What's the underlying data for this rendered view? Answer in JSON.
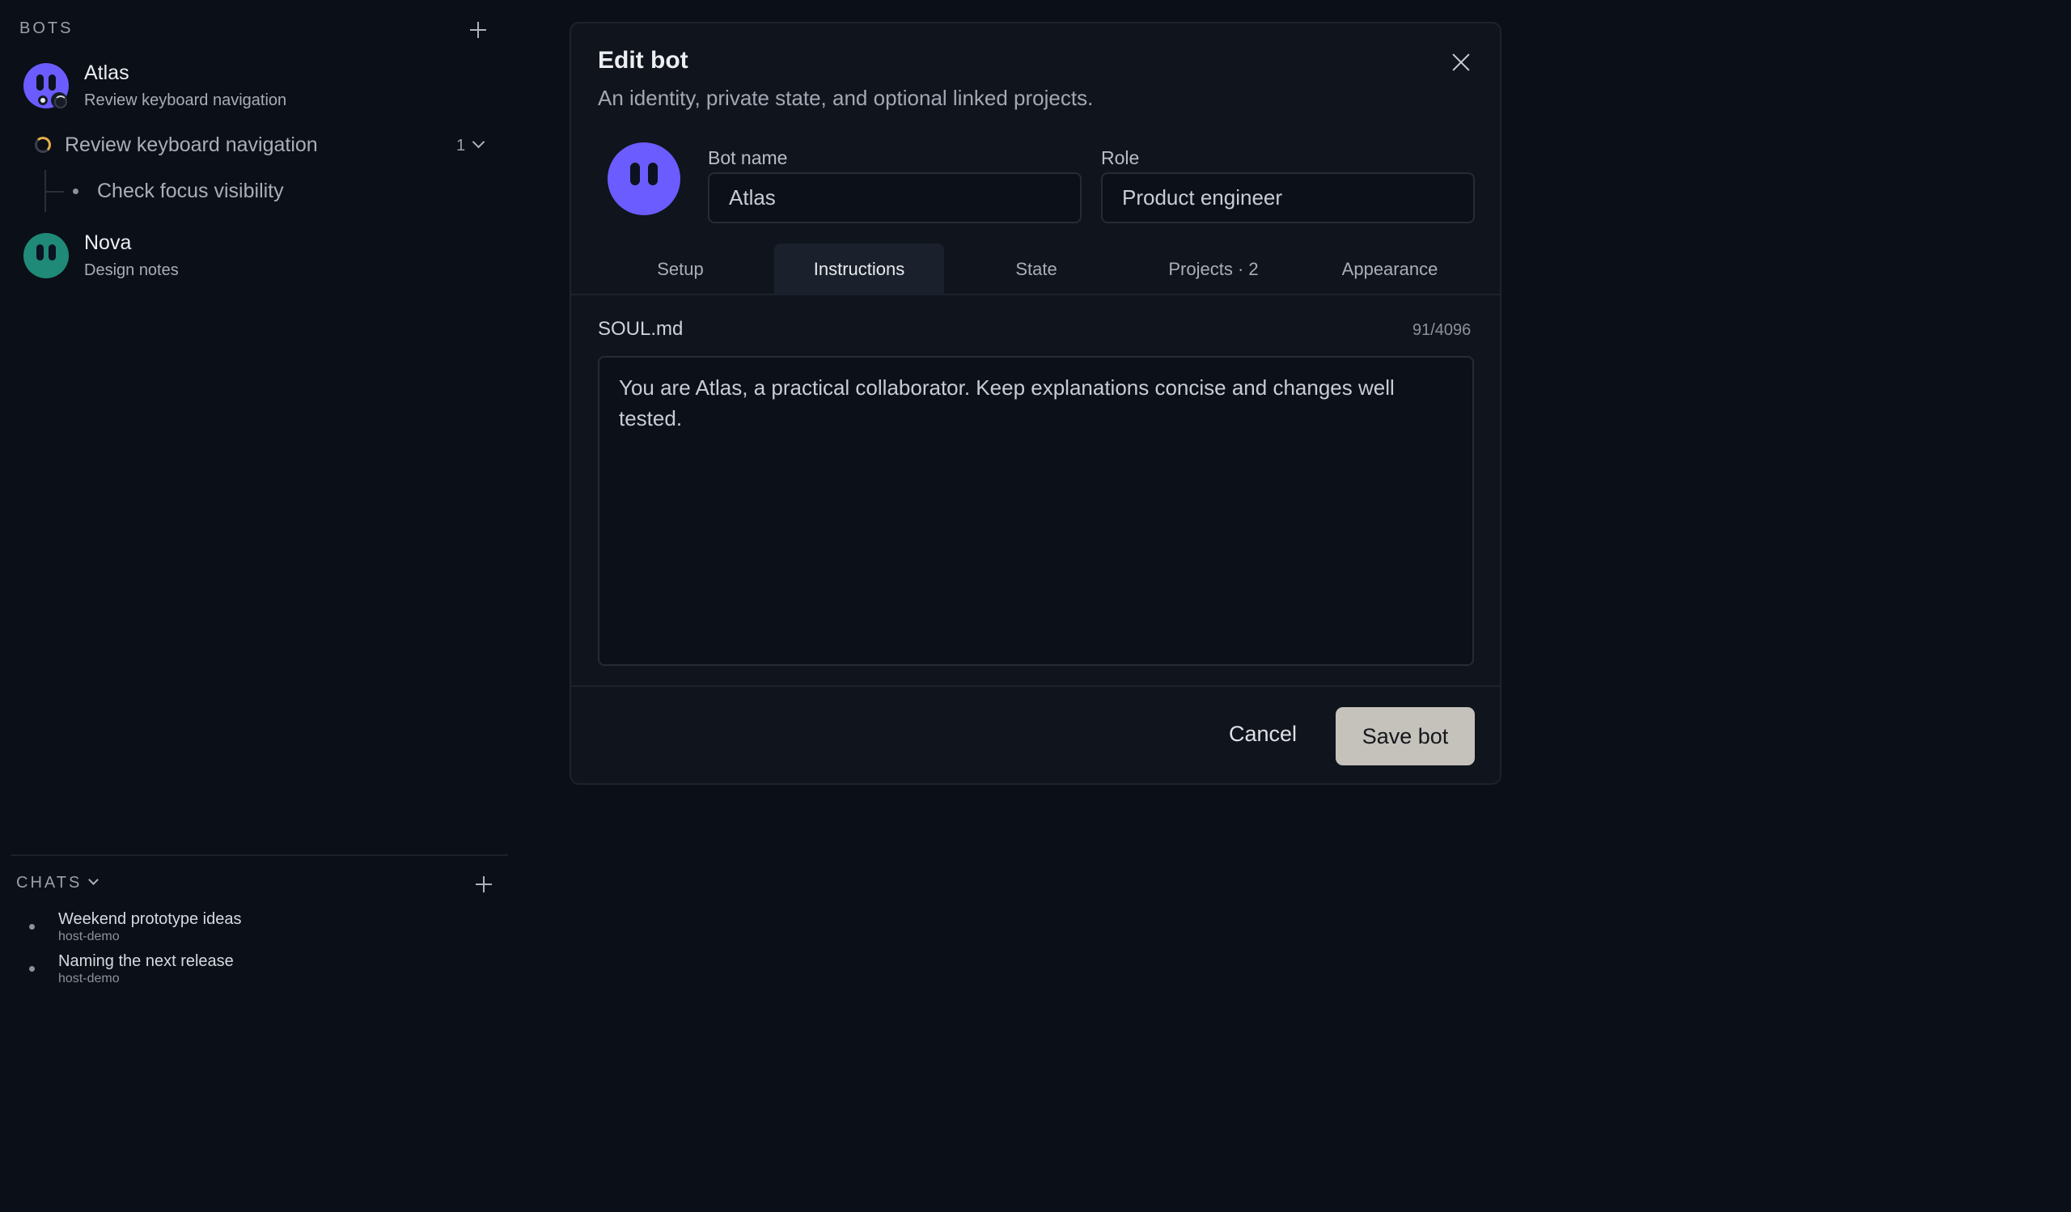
{
  "sidebar": {
    "bots_header": "BOTS",
    "bots": [
      {
        "name": "Atlas",
        "subtitle": "Review keyboard navigation",
        "avatar_color": "#6b5cff",
        "task": {
          "label": "Review keyboard navigation",
          "count": "1"
        },
        "subtask": "Check focus visibility"
      },
      {
        "name": "Nova",
        "subtitle": "Design notes",
        "avatar_color": "#1f8a78"
      }
    ],
    "chats_header": "CHATS",
    "chats": [
      {
        "title": "Weekend prototype ideas",
        "host": "host-demo"
      },
      {
        "title": "Naming the next release",
        "host": "host-demo"
      }
    ]
  },
  "modal": {
    "title": "Edit bot",
    "subtitle": "An identity, private state, and optional linked projects.",
    "avatar_color": "#6b5cff",
    "bot_name_label": "Bot name",
    "bot_name_value": "Atlas",
    "role_label": "Role",
    "role_value": "Product engineer",
    "tabs": [
      {
        "label": "Setup",
        "active": false
      },
      {
        "label": "Instructions",
        "active": true
      },
      {
        "label": "State",
        "active": false
      },
      {
        "label": "Projects · 2",
        "active": false
      },
      {
        "label": "Appearance",
        "active": false
      }
    ],
    "file_name": "SOUL.md",
    "char_count": "91/4096",
    "instructions": "You are Atlas, a practical collaborator. Keep explanations concise and changes well tested.",
    "cancel_label": "Cancel",
    "save_label": "Save bot"
  }
}
